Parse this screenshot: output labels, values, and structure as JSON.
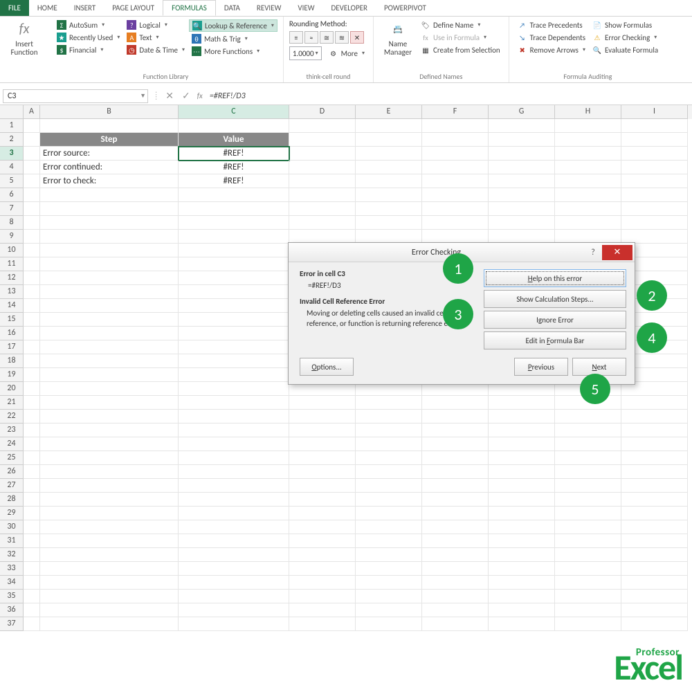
{
  "tabs": {
    "file": "FILE",
    "home": "HOME",
    "insert": "INSERT",
    "pagelayout": "PAGE LAYOUT",
    "formulas": "FORMULAS",
    "data": "DATA",
    "review": "REVIEW",
    "view": "VIEW",
    "developer": "DEVELOPER",
    "powerpivot": "POWERPIVOT"
  },
  "ribbon": {
    "insert_function": "Insert\nFunction",
    "autosum": "AutoSum",
    "recently_used": "Recently Used",
    "financial": "Financial",
    "logical": "Logical",
    "text": "Text",
    "date_time": "Date & Time",
    "lookup": "Lookup & Reference",
    "math_trig": "Math & Trig",
    "more_funcs": "More Functions",
    "group_function_library": "Function Library",
    "rounding_method": "Rounding Method:",
    "tc_value": "1.0000",
    "more": "More",
    "group_thinkcell": "think-cell round",
    "name_manager": "Name\nManager",
    "define_name": "Define Name",
    "use_in_formula": "Use in Formula",
    "create_from_sel": "Create from Selection",
    "group_defined_names": "Defined Names",
    "trace_prec": "Trace Precedents",
    "trace_dep": "Trace Dependents",
    "remove_arrows": "Remove Arrows",
    "show_formulas": "Show Formulas",
    "error_checking": "Error Checking",
    "evaluate_formula": "Evaluate Formula",
    "group_formula_auditing": "Formula Auditing"
  },
  "formula_bar": {
    "cell_ref": "C3",
    "formula": "=#REF!/D3",
    "fx": "fx"
  },
  "columns": [
    "A",
    "B",
    "C",
    "D",
    "E",
    "F",
    "G",
    "H",
    "I"
  ],
  "rows_count": 37,
  "table": {
    "header": {
      "step": "Step",
      "value": "Value"
    },
    "r3": {
      "b": "Error source:",
      "c": "#REF!"
    },
    "r4": {
      "b": "Error continued:",
      "c": "#REF!"
    },
    "r5": {
      "b": "Error to check:",
      "c": "#REF!"
    }
  },
  "dialog": {
    "title": "Error Checking",
    "error_in": "Error in cell C3",
    "formula": "=#REF!/D3",
    "error_name": "Invalid Cell Reference Error",
    "desc": "Moving or deleting cells caused an invalid cell reference, or function is returning reference error.",
    "help": "Help on this error",
    "show_steps": "Show Calculation Steps...",
    "ignore": "Ignore Error",
    "edit": "Edit in Formula Bar",
    "options": "Options...",
    "previous": "Previous",
    "next": "Next",
    "help_icon": "?",
    "close_icon": "✕"
  },
  "annotations": {
    "1": "1",
    "2": "2",
    "3": "3",
    "4": "4",
    "5": "5"
  },
  "watermark": {
    "small": "Professor",
    "big": "Excel"
  }
}
